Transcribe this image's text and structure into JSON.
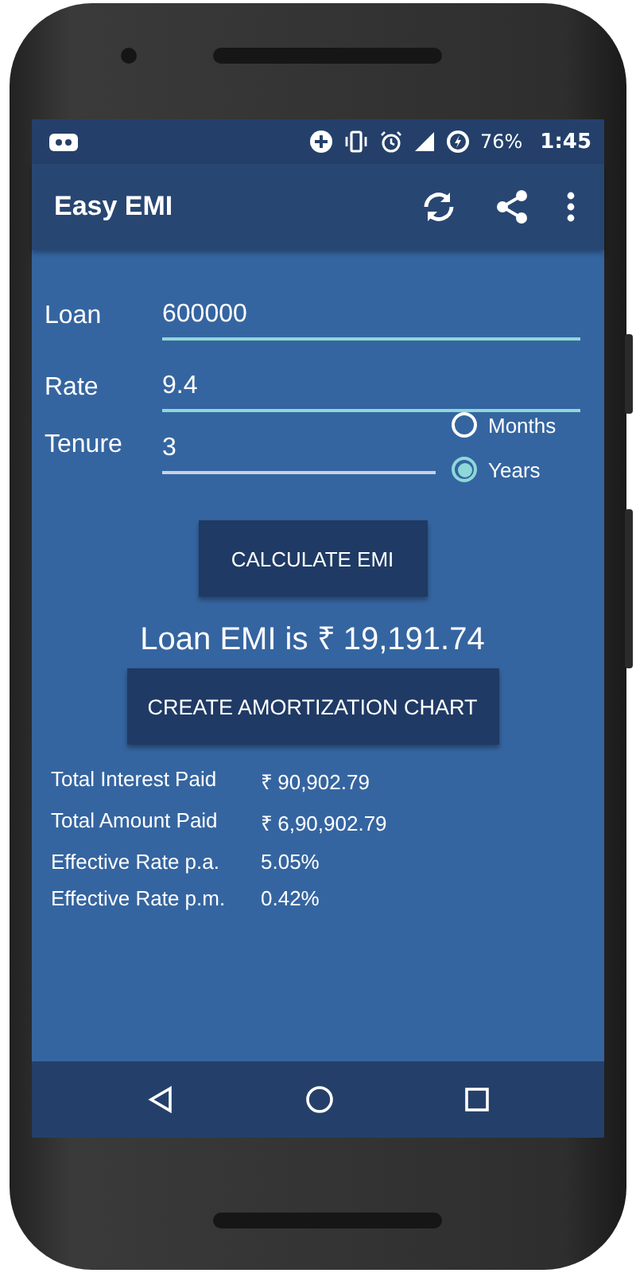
{
  "status_bar": {
    "battery": "76%",
    "time": "1:45"
  },
  "app_bar": {
    "title": "Easy EMI"
  },
  "fields": [
    {
      "label": "Loan",
      "value": "600000"
    },
    {
      "label": "Rate",
      "value": "9.4"
    },
    {
      "label": "Tenure",
      "value": "3"
    }
  ],
  "tenure_units": [
    {
      "label": "Months",
      "selected": false
    },
    {
      "label": "Years",
      "selected": true
    }
  ],
  "calculate_button": "CALCULATE EMI",
  "result": "Loan EMI is ₹ 19,191.74",
  "chart_button": "CREATE AMORTIZATION CHART",
  "summary": [
    {
      "label": "Total Interest Paid",
      "value": "₹ 90,902.79"
    },
    {
      "label": "Total Amount Paid",
      "value": "₹ 6,90,902.79"
    },
    {
      "label": "Effective Rate p.a.",
      "value": "5.05%"
    },
    {
      "label": "Effective Rate p.m.",
      "value": "0.42%"
    }
  ]
}
